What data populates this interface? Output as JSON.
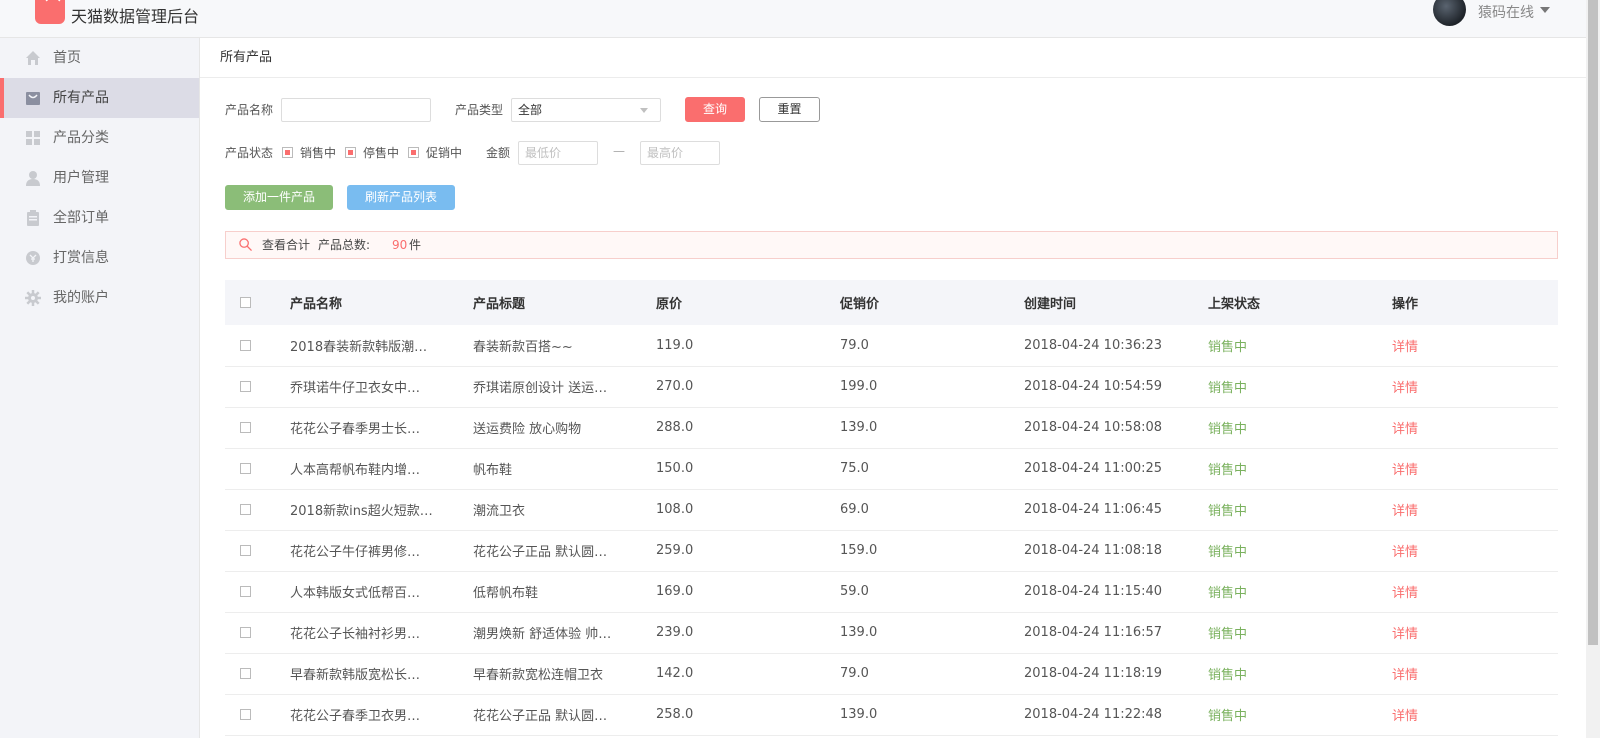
{
  "app": {
    "title": "天猫数据管理后台",
    "user_name": "猿码在线"
  },
  "sidebar": {
    "items": [
      {
        "label": "首页",
        "icon": "home-icon"
      },
      {
        "label": "所有产品",
        "icon": "bag-icon",
        "active": true
      },
      {
        "label": "产品分类",
        "icon": "grid-icon"
      },
      {
        "label": "用户管理",
        "icon": "user-icon"
      },
      {
        "label": "全部订单",
        "icon": "clipboard-icon"
      },
      {
        "label": "打赏信息",
        "icon": "coin-icon"
      },
      {
        "label": "我的账户",
        "icon": "gear-icon"
      }
    ]
  },
  "page": {
    "title": "所有产品"
  },
  "filters": {
    "name_label": "产品名称",
    "name_value": "",
    "type_label": "产品类型",
    "type_value": "全部",
    "query_label": "查询",
    "reset_label": "重置",
    "status_label": "产品状态",
    "status_options": [
      "销售中",
      "停售中",
      "促销中"
    ],
    "amount_label": "金额",
    "min_placeholder": "最低价",
    "max_placeholder": "最高价",
    "dash": "—"
  },
  "actions": {
    "add_label": "添加一件产品",
    "refresh_label": "刷新产品列表"
  },
  "summary": {
    "view_label": "查看合计",
    "total_label": "产品总数:",
    "total_value": "90",
    "unit": "件"
  },
  "table": {
    "columns": [
      "产品名称",
      "产品标题",
      "原价",
      "促销价",
      "创建时间",
      "上架状态",
      "操作"
    ],
    "rows": [
      {
        "name": "2018春装新款韩版潮…",
        "title": "春装新款百搭~~",
        "price": "119.0",
        "promo": "79.0",
        "time": "2018-04-24 10:36:23",
        "status": "销售中",
        "op": "详情"
      },
      {
        "name": "乔琪诺牛仔卫衣女中…",
        "title": "乔琪诺原创设计 送运…",
        "price": "270.0",
        "promo": "199.0",
        "time": "2018-04-24 10:54:59",
        "status": "销售中",
        "op": "详情"
      },
      {
        "name": "花花公子春季男士长…",
        "title": "送运费险 放心购物",
        "price": "288.0",
        "promo": "139.0",
        "time": "2018-04-24 10:58:08",
        "status": "销售中",
        "op": "详情"
      },
      {
        "name": "人本高帮帆布鞋内增…",
        "title": "帆布鞋",
        "price": "150.0",
        "promo": "75.0",
        "time": "2018-04-24 11:00:25",
        "status": "销售中",
        "op": "详情"
      },
      {
        "name": "2018新款ins超火短款…",
        "title": "潮流卫衣",
        "price": "108.0",
        "promo": "69.0",
        "time": "2018-04-24 11:06:45",
        "status": "销售中",
        "op": "详情"
      },
      {
        "name": "花花公子牛仔裤男修…",
        "title": "花花公子正品 默认圆…",
        "price": "259.0",
        "promo": "159.0",
        "time": "2018-04-24 11:08:18",
        "status": "销售中",
        "op": "详情"
      },
      {
        "name": "人本韩版女式低帮百…",
        "title": "低帮帆布鞋",
        "price": "169.0",
        "promo": "59.0",
        "time": "2018-04-24 11:15:40",
        "status": "销售中",
        "op": "详情"
      },
      {
        "name": "花花公子长袖衬衫男…",
        "title": "潮男焕新 舒适体验 帅…",
        "price": "239.0",
        "promo": "139.0",
        "time": "2018-04-24 11:16:57",
        "status": "销售中",
        "op": "详情"
      },
      {
        "name": "早春新款韩版宽松长…",
        "title": "早春新款宽松连帽卫衣",
        "price": "142.0",
        "promo": "79.0",
        "time": "2018-04-24 11:18:19",
        "status": "销售中",
        "op": "详情"
      },
      {
        "name": "花花公子春季卫衣男…",
        "title": "花花公子正品 默认圆…",
        "price": "258.0",
        "promo": "139.0",
        "time": "2018-04-24 11:22:48",
        "status": "销售中",
        "op": "详情"
      }
    ]
  },
  "colors": {
    "accent": "#fa6e6e",
    "green_button": "#8bbd78",
    "blue_button": "#79bcf0",
    "status_green": "#7ab15e"
  }
}
